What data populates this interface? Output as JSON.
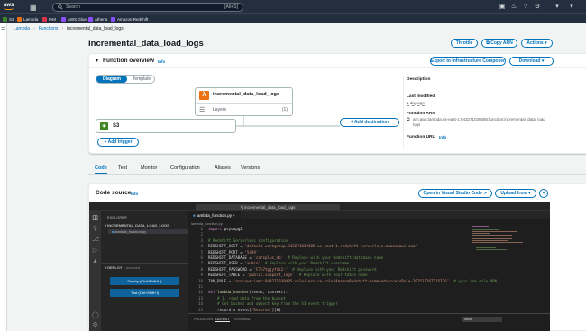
{
  "topnav": {
    "logo": "aws",
    "services_icon": "grid-icon",
    "search_placeholder": "Search",
    "search_shortcut": "[Alt+S]",
    "favorites": [
      {
        "label": "S3",
        "color": "#3f8624"
      },
      {
        "label": "Lambda",
        "color": "#ec7211"
      },
      {
        "label": "IAM",
        "color": "#dd344c"
      },
      {
        "label": "AWS Glue",
        "color": "#8c4fff"
      },
      {
        "label": "Athena",
        "color": "#8c4fff"
      },
      {
        "label": "Amazon Redshift",
        "color": "#8c4fff"
      }
    ]
  },
  "breadcrumb": {
    "lambda": "Lambda",
    "functions": "Functions",
    "current": "incremental_data_load_logs"
  },
  "page": {
    "title": "incremental_data_load_logs",
    "throttle": "Throttle",
    "copy_arn": "Copy ARN",
    "actions": "Actions ▾"
  },
  "overview": {
    "title": "Function overview",
    "info": "Info",
    "export_composer": "Export to Infrastructure Composer",
    "download": "Download ▾",
    "tab_diagram": "Diagram",
    "tab_template": "Template",
    "function_name": "incremental_data_load_logs",
    "layers_label": "Layers",
    "layers_count": "(1)",
    "trigger_name": "S3",
    "add_trigger": "+ Add trigger",
    "add_destination": "+ Add destination",
    "description_label": "Description",
    "description_value": "-",
    "last_modified_label": "Last modified",
    "last_modified_value": "1 day ago",
    "arn_label": "Function ARN",
    "arn_value": "arn:aws:lambda:us-east-1:943271039485:function:incremental_data_load_logs",
    "url_label": "Function URL",
    "url_info": "Info",
    "url_value": "-"
  },
  "tabs": [
    "Code",
    "Test",
    "Monitor",
    "Configuration",
    "Aliases",
    "Versions"
  ],
  "code_source": {
    "title": "Code source",
    "info": "Info",
    "open_vscode": "Open in Visual Studio Code",
    "upload_from": "Upload from ▾",
    "ide_search": "incremental_data_load_logs",
    "explorer_title": "EXPLORER",
    "folder_name": "INCREMENTAL_DATA_LOAD_LOGS",
    "file_name": "lambda_function.py",
    "deploy_header": "DEPLOY",
    "deploy_status": "1 unsaved",
    "deploy_button": "Deploy (Ctrl+Shift+U)",
    "test_button": "Test (Ctrl+Shift+I)",
    "editor_tab": "lambda_function.py",
    "editor_breadcrumb": "lambda_function.py",
    "panel_tabs": [
      "PROBLEMS",
      "OUTPUT",
      "TERMINAL"
    ],
    "tasks": "Tasks"
  },
  "code_lines": [
    "import psycopg2",
    "",
    "# Redshift Serverless configuration",
    "REDSHIFT_HOST = 'default-workgroup.943271039485.us-east-1.redshift-serverless.amazonaws.com'",
    "REDSHIFT_PORT = '5439'",
    "REDSHIFT_DATABASE = 'carsplus_db'  # Replace with your Redshift database name",
    "REDSHIFT_USER = 'admin'  # Replace with your Redshift username",
    "REDSHIFT_PASSWORD = 'F7n7tgjyf4s2-'  # Replace with your Redshift password",
    "REDSHIFT_TABLE = 'public.support_logs'  # Replace with your table name",
    "IAM_ROLE = 'arn:aws:iam::943271039485:role/service-role/AmazonRedshift-CommandsAccessRole-20251126T115726'  # your iam role ARN",
    "",
    "def lambda_handler(event, context):",
    "    # 1. read data from the bucket",
    "    # Get bucket and object key from the S3 event trigger",
    "    record = event['Records'][0]"
  ]
}
